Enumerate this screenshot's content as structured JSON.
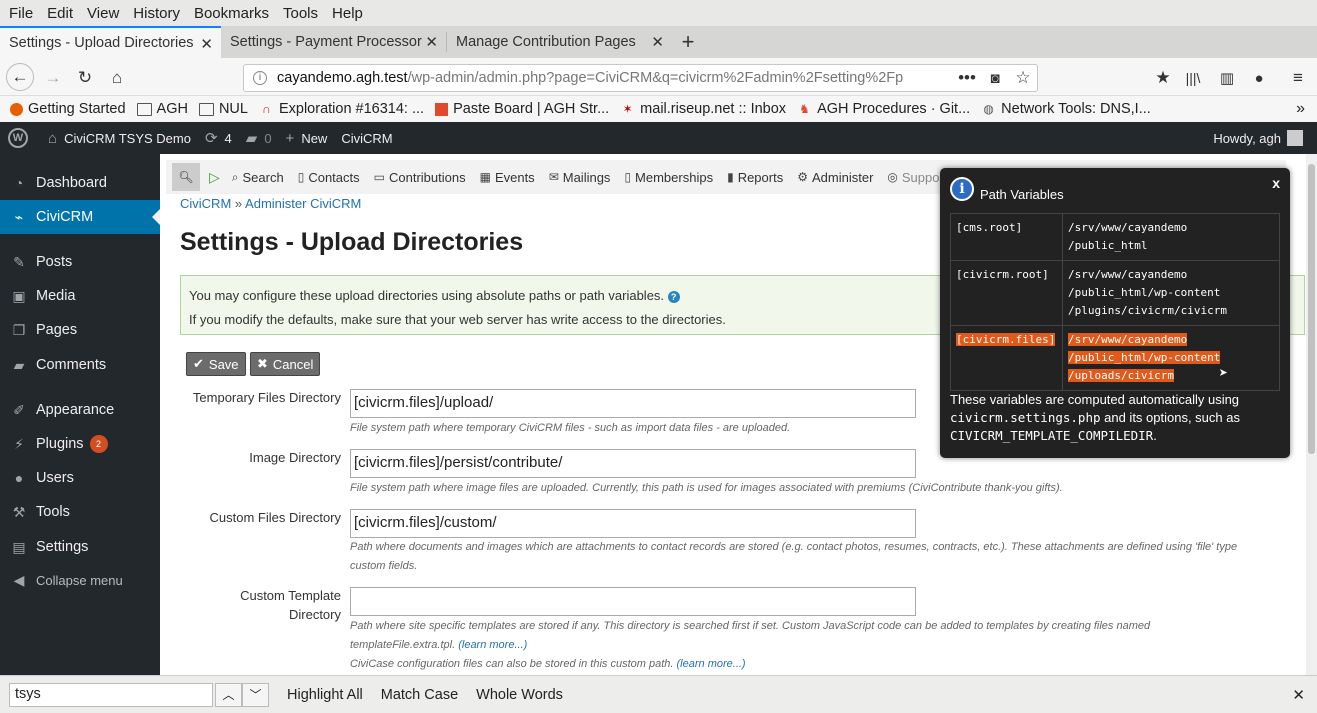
{
  "menubar": [
    "File",
    "Edit",
    "View",
    "History",
    "Bookmarks",
    "Tools",
    "Help"
  ],
  "tabs": [
    {
      "label": "Settings - Upload Directories",
      "active": true
    },
    {
      "label": "Settings - Payment Processor",
      "active": false
    },
    {
      "label": "Manage Contribution Pages",
      "active": false
    }
  ],
  "url": {
    "host": "cayandemo.agh.test",
    "path": "/wp-admin/admin.php?page=CiviCRM&q=civicrm%2Fadmin%2Fsetting%2Fp"
  },
  "bookmarks": [
    "Getting Started",
    "AGH",
    "NUL",
    "Exploration #16314: ...",
    "Paste Board | AGH Str...",
    "mail.riseup.net :: Inbox",
    "AGH Procedures · Git...",
    "Network Tools: DNS,I..."
  ],
  "adminbar": {
    "site": "CiviCRM TSYS Demo",
    "updates": "4",
    "comments": "0",
    "new": "New",
    "civicrm": "CiviCRM",
    "howdy": "Howdy, agh"
  },
  "sidebar": [
    {
      "label": "Dashboard",
      "icon": "dashboard-icon"
    },
    {
      "label": "CiviCRM",
      "icon": "civicrm-icon",
      "current": true
    },
    {
      "label": "Posts",
      "icon": "pin-icon"
    },
    {
      "label": "Media",
      "icon": "media-icon"
    },
    {
      "label": "Pages",
      "icon": "pages-icon"
    },
    {
      "label": "Comments",
      "icon": "comment-icon"
    },
    {
      "label": "Appearance",
      "icon": "brush-icon"
    },
    {
      "label": "Plugins",
      "icon": "plugin-icon",
      "badge": "2"
    },
    {
      "label": "Users",
      "icon": "user-icon"
    },
    {
      "label": "Tools",
      "icon": "wrench-icon"
    },
    {
      "label": "Settings",
      "icon": "settings-icon"
    },
    {
      "label": "Collapse menu",
      "icon": "collapse-icon"
    }
  ],
  "civinav": [
    "Search",
    "Contacts",
    "Contributions",
    "Events",
    "Mailings",
    "Memberships",
    "Reports",
    "Administer",
    "Support"
  ],
  "breadcrumb": {
    "a": "CiviCRM",
    "sep": "»",
    "b": "Administer CiviCRM"
  },
  "page_title": "Settings - Upload Directories",
  "help": {
    "line1": "You may configure these upload directories using absolute paths or path variables.",
    "line2": "If you modify the defaults, make sure that your web server has write access to the directories."
  },
  "buttons": {
    "save": "Save",
    "cancel": "Cancel"
  },
  "fields": [
    {
      "label": "Temporary Files Directory",
      "value": "[civicrm.files]/upload/",
      "desc": "File system path where temporary CiviCRM files - such as import data files - are uploaded."
    },
    {
      "label": "Image Directory",
      "value": "[civicrm.files]/persist/contribute/",
      "desc": "File system path where image files are uploaded. Currently, this path is used for images associated with premiums (CiviContribute thank-you gifts)."
    },
    {
      "label": "Custom Files Directory",
      "value": "[civicrm.files]/custom/",
      "desc1": "Path where documents and images which are attachments to contact records are stored (e.g. contact photos, resumes, contracts, etc.). These attachments are defined using 'file' type",
      "desc2": "custom fields."
    },
    {
      "label1": "Custom Template",
      "label2": "Directory",
      "value": "",
      "desc1": "Path where site specific templates are stored if any. This directory is searched first if set. Custom JavaScript code can be added to templates by creating files named",
      "desc2": "templateFile.extra.tpl.",
      "link": "(learn more...)",
      "desc3": "CiviCase configuration files can also be stored in this custom path."
    }
  ],
  "popup": {
    "title": "Path Variables",
    "rows": [
      {
        "key": "[cms.root]",
        "val": [
          "/srv/www/cayandemo",
          "/public_html"
        ]
      },
      {
        "key": "[civicrm.root]",
        "val": [
          "/srv/www/cayandemo",
          "/public_html/wp-content",
          "/plugins/civicrm/civicrm"
        ]
      },
      {
        "key": "[civicrm.files]",
        "val": [
          "/srv/www/cayandemo",
          "/public_html/wp-content",
          "/uploads/civicrm"
        ],
        "highlight": true
      }
    ],
    "note1": "These variables are computed automatically using",
    "note_code1": "civicrm.settings.php",
    "note2": " and its options, such as",
    "note_code2": "CIVICRM_TEMPLATE_COMPILEDIR",
    "note3": "."
  },
  "findbar": {
    "query": "tsys",
    "highlight_all": "Highlight All",
    "match_case": "Match Case",
    "whole_words": "Whole Words"
  }
}
